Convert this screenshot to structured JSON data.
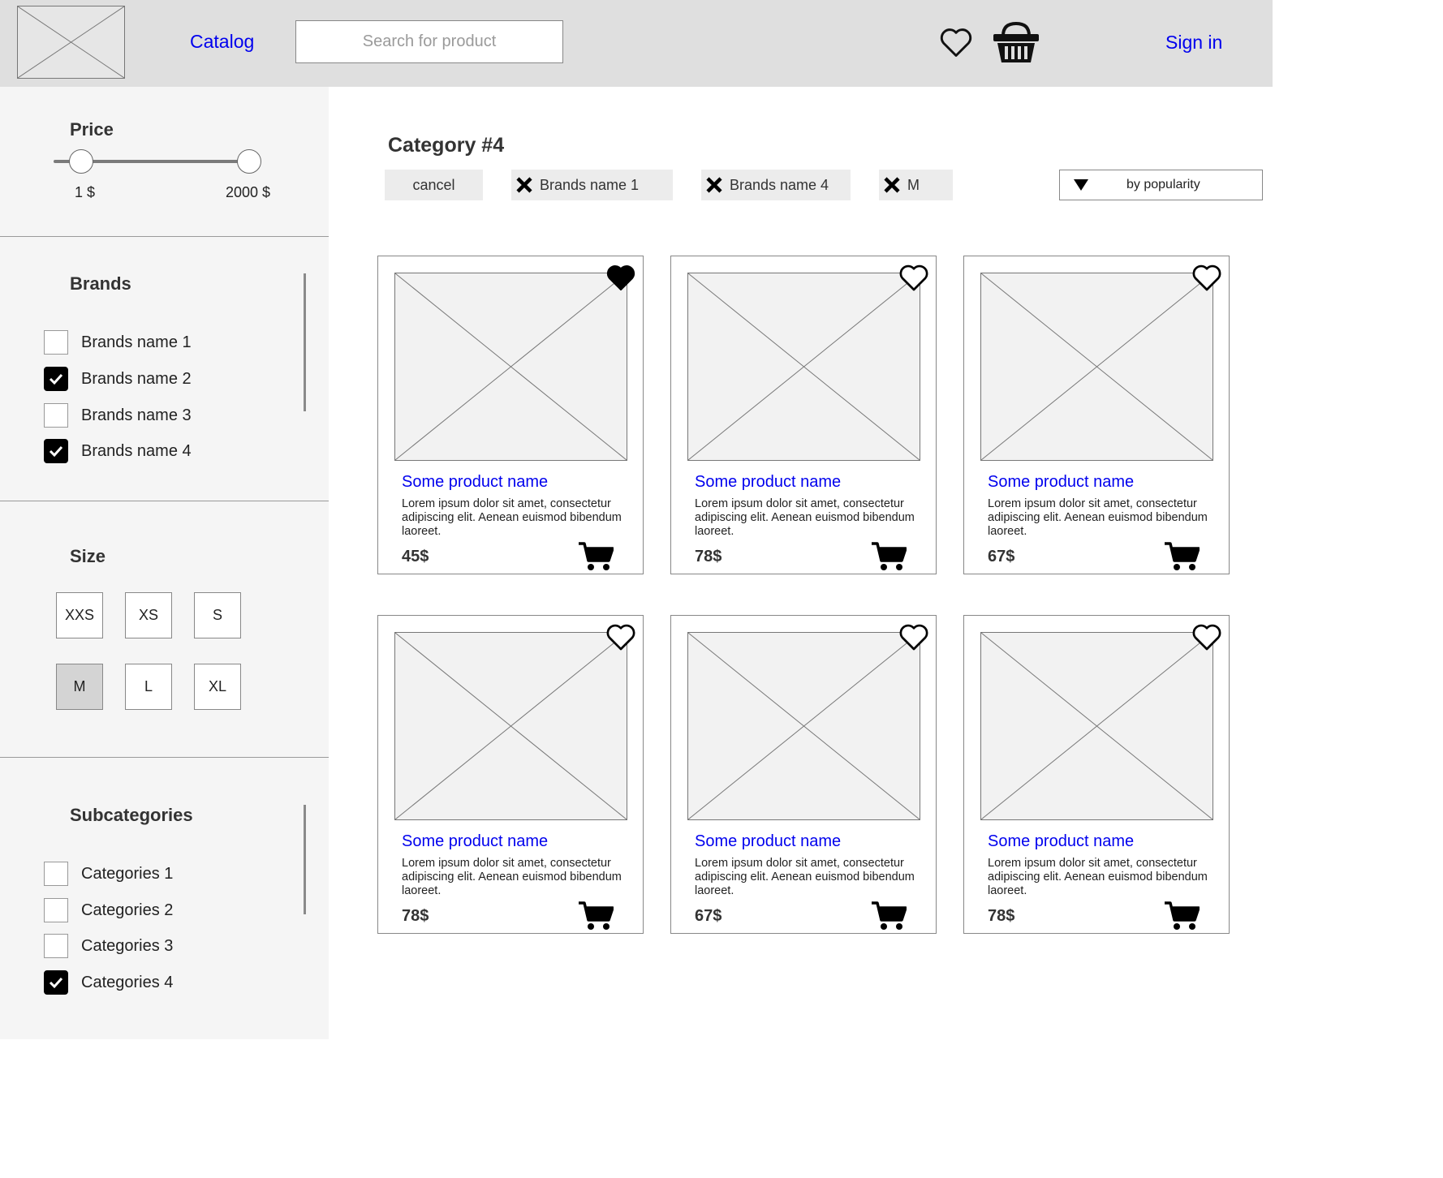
{
  "header": {
    "catalog_label": "Catalog",
    "search_placeholder": "Search for product",
    "signin_label": "Sign in",
    "icons": [
      "logo-placeholder",
      "heart-icon",
      "basket-icon"
    ]
  },
  "sidebar": {
    "price": {
      "title": "Price",
      "min_label": "1 $",
      "max_label": "2000 $",
      "range": [
        1,
        2000
      ],
      "selected_range": [
        1,
        2000
      ]
    },
    "brands": {
      "title": "Brands",
      "items": [
        {
          "label": "Brands name 1",
          "checked": false
        },
        {
          "label": "Brands name 2",
          "checked": true
        },
        {
          "label": "Brands name 3",
          "checked": false
        },
        {
          "label": "Brands name 4",
          "checked": true
        }
      ]
    },
    "size": {
      "title": "Size",
      "items": [
        {
          "label": "XXS",
          "selected": false
        },
        {
          "label": "XS",
          "selected": false
        },
        {
          "label": "S",
          "selected": false
        },
        {
          "label": "M",
          "selected": true
        },
        {
          "label": "L",
          "selected": false
        },
        {
          "label": "XL",
          "selected": false
        }
      ]
    },
    "subcategories": {
      "title": "Subcategories",
      "items": [
        {
          "label": "Categories 1",
          "checked": false
        },
        {
          "label": "Categories 2",
          "checked": false
        },
        {
          "label": "Categories 3",
          "checked": false
        },
        {
          "label": "Categories 4",
          "checked": true
        }
      ]
    }
  },
  "main": {
    "title": "Category #4",
    "cancel_label": "cancel",
    "active_filters": [
      "Brands name 1",
      "Brands name 4",
      "M"
    ],
    "sort_label": "by popularity",
    "products": [
      {
        "name": "Some product name",
        "description": "Lorem ipsum dolor sit amet, consectetur adipiscing elit. Aenean euismod bibendum laoreet.",
        "price": "45$",
        "favorite": true
      },
      {
        "name": "Some product name",
        "description": "Lorem ipsum dolor sit amet, consectetur adipiscing elit. Aenean euismod bibendum laoreet.",
        "price": "78$",
        "favorite": false
      },
      {
        "name": "Some product name",
        "description": "Lorem ipsum dolor sit amet, consectetur adipiscing elit. Aenean euismod bibendum laoreet.",
        "price": "67$",
        "favorite": false
      },
      {
        "name": "Some product name",
        "description": "Lorem ipsum dolor sit amet, consectetur adipiscing elit. Aenean euismod bibendum laoreet.",
        "price": "78$",
        "favorite": false
      },
      {
        "name": "Some product name",
        "description": "Lorem ipsum dolor sit amet, consectetur adipiscing elit. Aenean euismod bibendum laoreet.",
        "price": "67$",
        "favorite": false
      },
      {
        "name": "Some product name",
        "description": "Lorem ipsum dolor sit amet, consectetur adipiscing elit. Aenean euismod bibendum laoreet.",
        "price": "78$",
        "favorite": false
      }
    ]
  },
  "colors": {
    "header_bg": "#dfdfdf",
    "sidebar_bg": "#f5f5f5",
    "link": "#0000ee",
    "chip_bg": "#ececec",
    "selected_size_bg": "#d4d4d4"
  }
}
